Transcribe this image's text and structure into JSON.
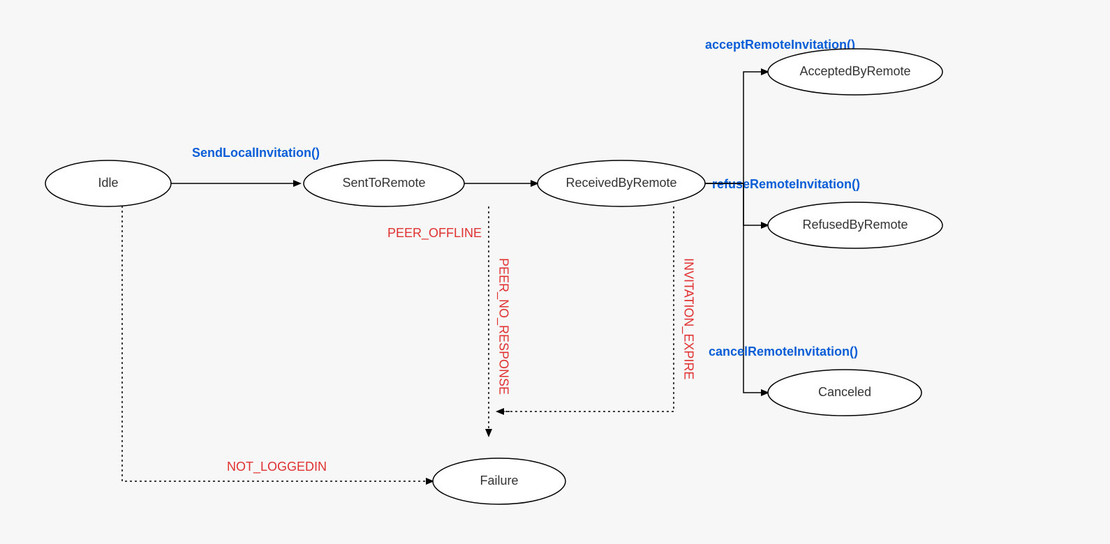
{
  "nodes": {
    "idle": "Idle",
    "sentToRemote": "SentToRemote",
    "receivedByRemote": "ReceivedByRemote",
    "acceptedByRemote": "AcceptedByRemote",
    "refusedByRemote": "RefusedByRemote",
    "canceled": "Canceled",
    "failure": "Failure"
  },
  "edges": {
    "sendLocalInvitation": "SendLocalInvitation()",
    "acceptRemoteInvitation": "acceptRemoteInvitation()",
    "refuseRemoteInvitation": "refuseRemoteInvitation()",
    "cancelRemoteInvitation": "cancelRemoteInvitation()",
    "peerOffline": "PEER_OFFLINE",
    "peerNoResponse": "PEER_NO_RESPONSE",
    "invitationExpire": "INVITATION_EXPIRE",
    "notLoggedIn": "NOT_LOGGEDIN"
  }
}
